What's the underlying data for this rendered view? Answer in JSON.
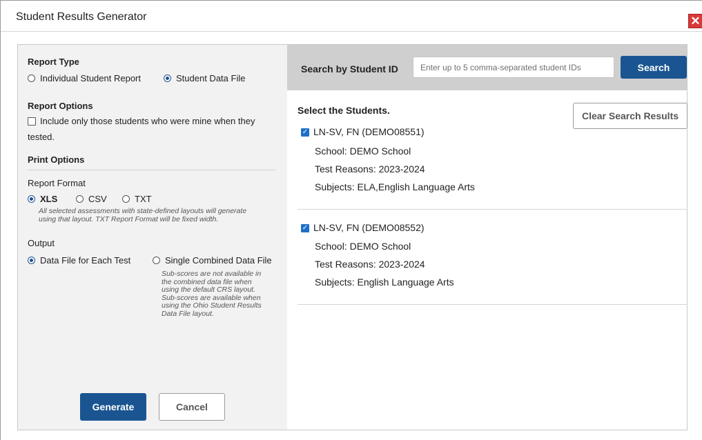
{
  "dialog": {
    "title": "Student Results Generator",
    "close_glyph": "✕"
  },
  "left": {
    "report_type": {
      "heading": "Report Type",
      "options": [
        "Individual Student Report",
        "Student Data File"
      ],
      "selected": "Student Data File"
    },
    "report_options": {
      "heading": "Report Options",
      "checkbox_label_line1": "Include only those students who were mine when they",
      "checkbox_label_line2": "tested.",
      "checked": false
    },
    "print_options": {
      "heading": "Print Options",
      "report_format_label": "Report Format",
      "formats": [
        "XLS",
        "CSV",
        "TXT"
      ],
      "selected_format": "XLS",
      "format_note_line1": "All selected assessments with state-defined layouts will generate",
      "format_note_line2": "using that layout. TXT Report Format will be fixed width.",
      "output_label": "Output",
      "outputs": [
        "Data File for Each Test",
        "Single Combined Data File"
      ],
      "selected_output": "Data File for Each Test",
      "output_note_lines": [
        "Sub-scores are not available in",
        "the combined data file when",
        "using the default CRS layout.",
        "Sub-scores are available when",
        "using the Ohio Student Results",
        "Data File layout."
      ]
    },
    "buttons": {
      "generate": "Generate",
      "cancel": "Cancel"
    }
  },
  "right": {
    "search": {
      "label": "Search by Student ID",
      "placeholder": "Enter up to 5 comma-separated student IDs",
      "button": "Search"
    },
    "select_heading": "Select the Students.",
    "clear_button": "Clear Search Results",
    "students": [
      {
        "name": "LN-SV, FN (DEMO08551)",
        "school": "School: DEMO School",
        "test_reasons": "Test Reasons: 2023-2024",
        "subjects": "Subjects: ELA,English Language Arts",
        "checked": true
      },
      {
        "name": "LN-SV, FN (DEMO08552)",
        "school": "School: DEMO School",
        "test_reasons": "Test Reasons: 2023-2024",
        "subjects": "Subjects: English Language Arts",
        "checked": true
      }
    ]
  },
  "colors": {
    "primary_button": "#1a5592",
    "close_button": "#d63a3a",
    "checkbox_checked": "#1f6fc8",
    "left_panel_bg": "#f2f2f2",
    "search_bar_bg": "#cfcfcf"
  }
}
